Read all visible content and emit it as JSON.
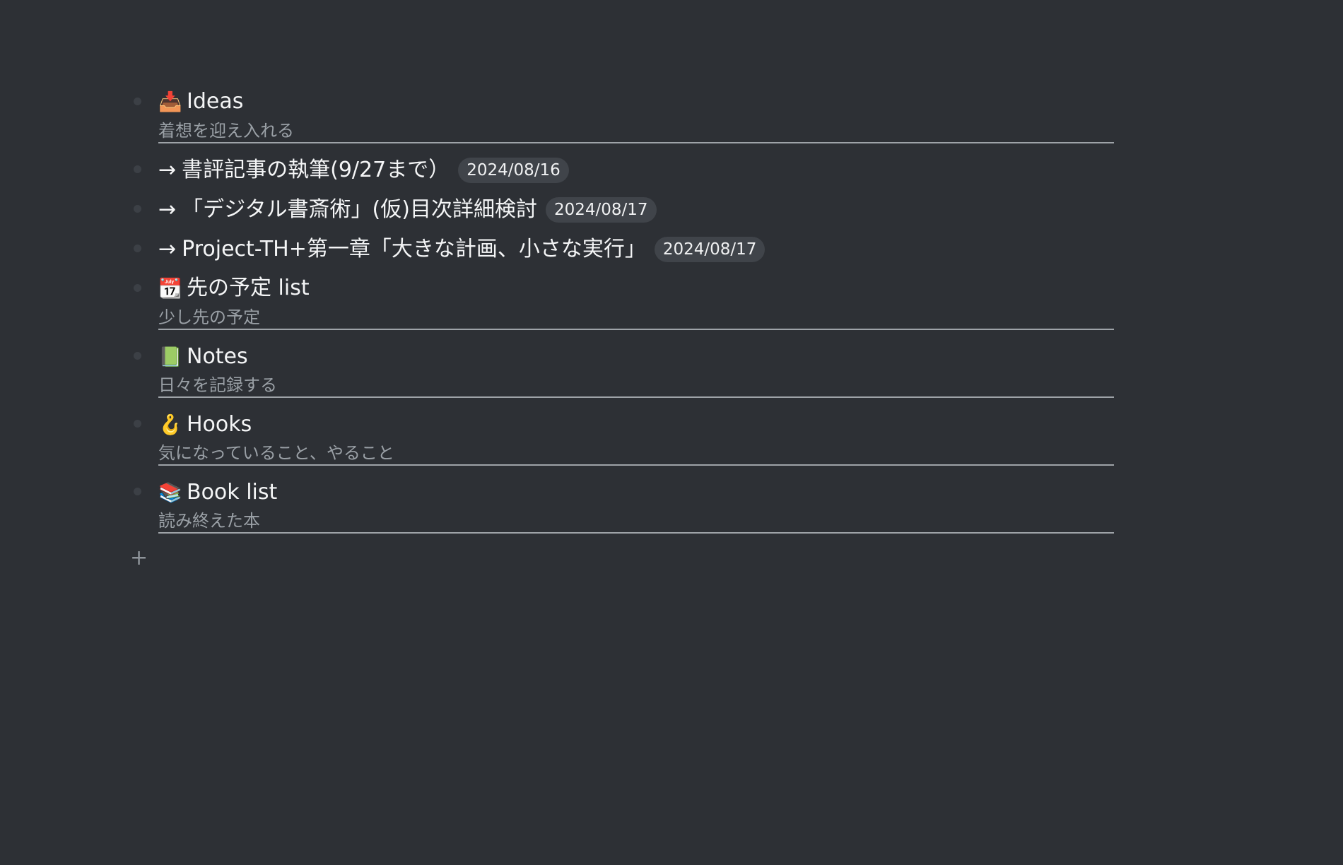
{
  "outline": {
    "items": [
      {
        "kind": "heading",
        "icon": "inbox-tray-icon",
        "emoji": "📥",
        "title": "Ideas",
        "note": "着想を迎え入れる"
      },
      {
        "kind": "task",
        "arrow": "→",
        "title": "書評記事の執筆(9/27まで）",
        "date": "2024/08/16"
      },
      {
        "kind": "task",
        "arrow": "→",
        "title": "「デジタル書斎術」(仮)目次詳細検討",
        "date": "2024/08/17"
      },
      {
        "kind": "task",
        "arrow": "→",
        "title": "Project-TH+第一章「大きな計画、小さな実行」",
        "date": "2024/08/17"
      },
      {
        "kind": "heading",
        "icon": "calendar-icon",
        "emoji": "📆",
        "title": "先の予定 list",
        "note": "少し先の予定"
      },
      {
        "kind": "heading",
        "icon": "green-book-icon",
        "emoji": "📗",
        "title": "Notes",
        "note": "日々を記録する"
      },
      {
        "kind": "heading",
        "icon": "hook-icon",
        "emoji": "🪝",
        "title": "Hooks",
        "note": "気になっていること、やること"
      },
      {
        "kind": "heading",
        "icon": "books-icon",
        "emoji": "📚",
        "title": "Book list",
        "note": "読み終えた本"
      }
    ],
    "add_label": "+"
  }
}
